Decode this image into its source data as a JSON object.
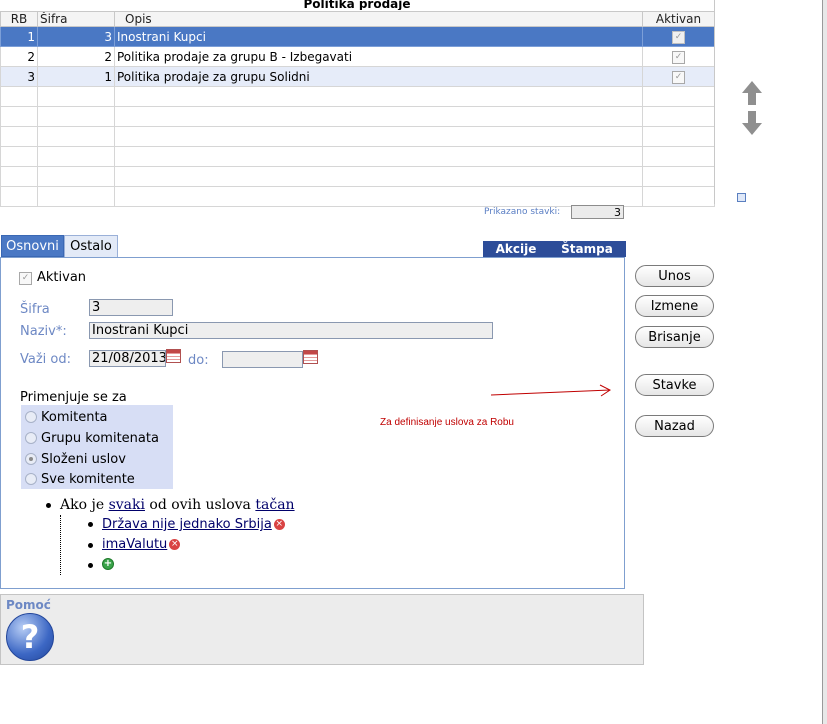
{
  "grid": {
    "title": "Politika prodaje",
    "columns": [
      "RB",
      "Šifra",
      "Opis",
      "Aktivan"
    ],
    "rows": [
      {
        "rb": "1",
        "sifra": "3",
        "opis": "Inostrani Kupci",
        "aktivan": "✓"
      },
      {
        "rb": "2",
        "sifra": "2",
        "opis": "Politika prodaje za grupu B - Izbegavati",
        "aktivan": "✓"
      },
      {
        "rb": "3",
        "sifra": "1",
        "opis": "Politika prodaje za grupu Solidni",
        "aktivan": "✓"
      }
    ],
    "count_label": "Prikazano stavki:",
    "count_value": "3"
  },
  "tabs": {
    "osnovni": "Osnovni",
    "ostalo": "Ostalo"
  },
  "actions": {
    "akcije": "Akcije",
    "stampa": "Štampa"
  },
  "form": {
    "aktivan_label": "Aktivan",
    "sifra_label": "Šifra",
    "sifra_value": "3",
    "naziv_label": "Naziv*:",
    "naziv_value": "Inostrani Kupci",
    "vazi_label": "Važi od:",
    "vazi_value": "21/08/2013",
    "do_label": "do:",
    "do_value": "",
    "primenjuje_label": "Primenjuje se za",
    "radio_options": [
      "Komitenta",
      "Grupu komitenata",
      "Složeni uslov",
      "Sve komitente"
    ],
    "radio_selected": "Složeni uslov"
  },
  "conditions": {
    "prefix": "Ako je",
    "svaki": "svaki",
    "middle": "od ovih uslova",
    "tacan": "tačan",
    "items": [
      "Država nije jednako Srbija",
      "imaValutu"
    ]
  },
  "annotation": "Za definisanje uslova za Robu",
  "buttons": {
    "unos": "Unos",
    "izmene": "Izmene",
    "brisanje": "Brisanje",
    "stavke": "Stavke",
    "nazad": "Nazad"
  },
  "help": {
    "label": "Pomoć",
    "icon_glyph": "?"
  },
  "colors": {
    "selected_row": "#4a78c4",
    "action_bar": "#2d4d99",
    "label": "#6d88c4",
    "annotation": "#c00000"
  }
}
